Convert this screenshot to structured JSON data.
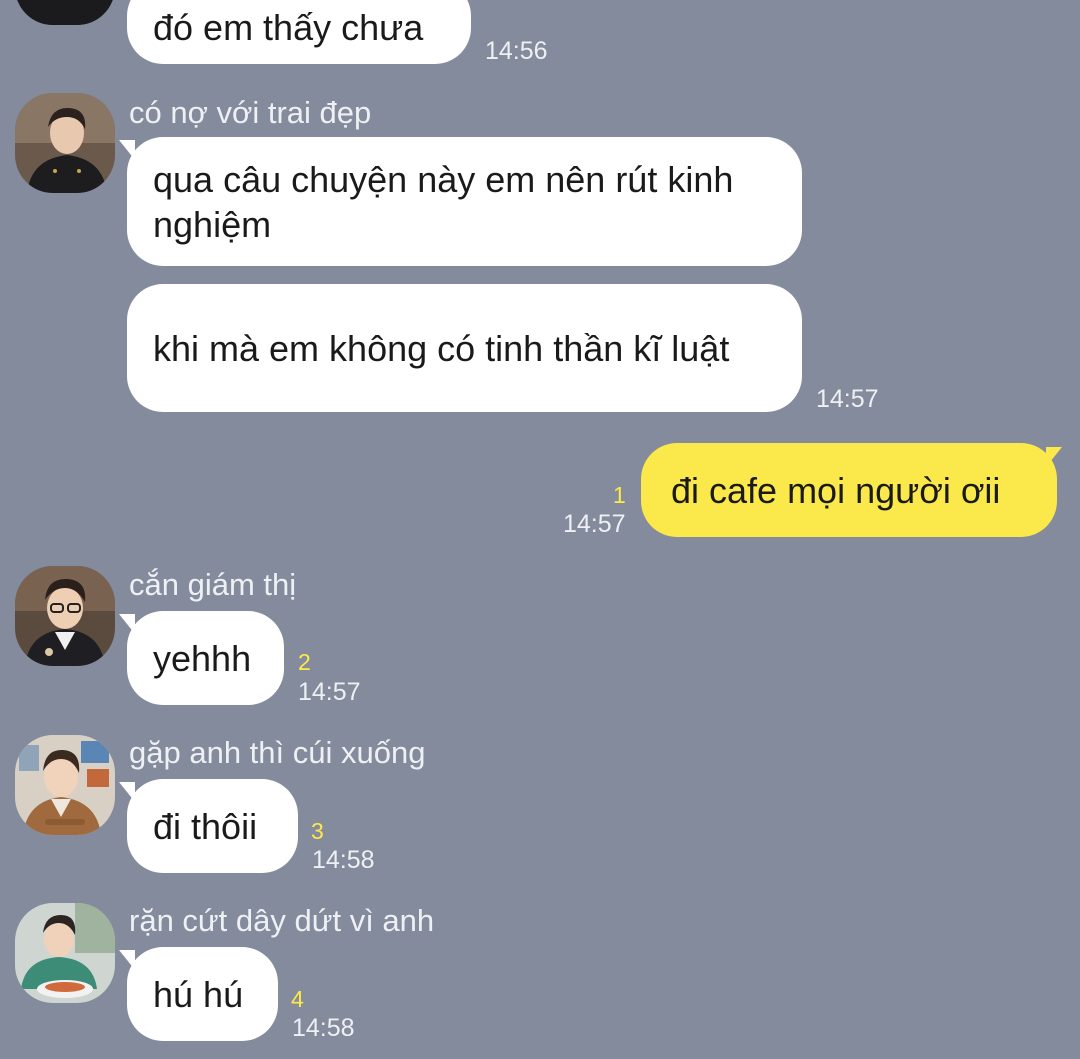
{
  "colors": {
    "background": "#838b9c",
    "incoming_bubble": "#ffffff",
    "outgoing_bubble": "#fbe84b",
    "text": "#1a1a1a",
    "meta_text": "#eef0f4",
    "unread": "#ffe94a"
  },
  "messages": [
    {
      "id": "m0",
      "direction": "incoming",
      "text": "đó em thấy chưa",
      "time": "14:56"
    },
    {
      "id": "m1",
      "direction": "incoming",
      "sender": "có nợ với trai đẹp",
      "avatar": "avatar-black-shirt",
      "text": "qua câu chuyện này em nên rút kinh nghiệm"
    },
    {
      "id": "m2",
      "direction": "incoming",
      "text": "khi mà em không có tinh thần kĩ luật",
      "time": "14:57"
    },
    {
      "id": "m3",
      "direction": "outgoing",
      "text": "đi cafe mọi người ơii",
      "unread": "1",
      "time": "14:57"
    },
    {
      "id": "m4",
      "direction": "incoming",
      "sender": "cắn giám thị",
      "avatar": "avatar-glasses-jacket",
      "text": "yehhh",
      "unread": "2",
      "time": "14:57"
    },
    {
      "id": "m5",
      "direction": "incoming",
      "sender": "gặp anh thì cúi xuống",
      "avatar": "avatar-brown-jacket",
      "text": "đi thôii",
      "unread": "3",
      "time": "14:58"
    },
    {
      "id": "m6",
      "direction": "incoming",
      "sender": "rặn cứt dây dứt vì anh",
      "avatar": "avatar-green-sweater",
      "text": "hú hú",
      "unread": "4",
      "time": "14:58"
    }
  ]
}
